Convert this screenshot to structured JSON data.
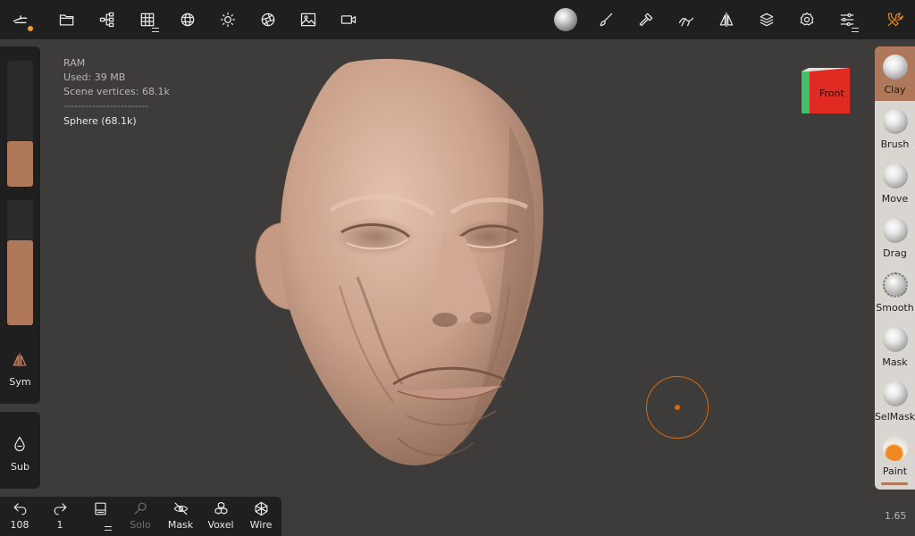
{
  "topbar": {
    "buttons": [
      "app-menu",
      "files",
      "scene",
      "topology",
      "wireframe-sphere",
      "lighting",
      "shading",
      "background",
      "video"
    ],
    "right_buttons": [
      "material",
      "paint-brush",
      "hammer",
      "stroke",
      "symmetry",
      "layers",
      "settings",
      "tool-settings",
      "tools"
    ]
  },
  "left": {
    "radius_fill": 0.36,
    "intensity_fill": 0.68,
    "sym_label": "Sym",
    "sub_label": "Sub"
  },
  "info": {
    "title": "RAM",
    "used": "Used: 39 MB",
    "vertices": "Scene vertices: 68.1k",
    "separator": "------------------------",
    "object": "Sphere (68.1k)"
  },
  "cube": {
    "face_label": "Front"
  },
  "tools": [
    {
      "label": "Clay"
    },
    {
      "label": "Brush"
    },
    {
      "label": "Move"
    },
    {
      "label": "Drag"
    },
    {
      "label": "Smooth"
    },
    {
      "label": "Mask"
    },
    {
      "label": "SelMask"
    },
    {
      "label": "Paint"
    }
  ],
  "bottom": {
    "undo_count": "108",
    "redo_count": "1",
    "solo": "Solo",
    "mask": "Mask",
    "voxel": "Voxel",
    "wire": "Wire"
  },
  "version": "1.65",
  "colors": {
    "accent": "#b0785a",
    "cursor": "#d66a10",
    "bar": "#1f1f1f",
    "viewport": "#3e3c3a",
    "skin": "#c89a84"
  }
}
